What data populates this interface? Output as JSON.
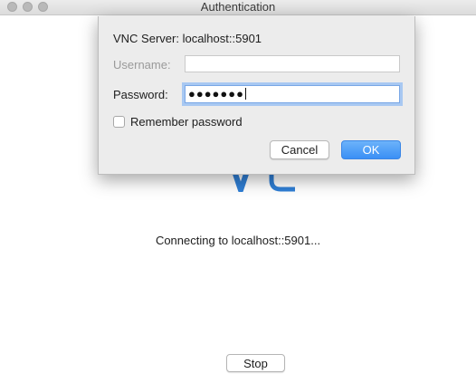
{
  "window": {
    "title": "Authentication"
  },
  "dialog": {
    "server_text": "VNC Server: localhost::5901",
    "username": {
      "label": "Username:",
      "value": ""
    },
    "password": {
      "label": "Password:",
      "masked_value": "●●●●●●●"
    },
    "remember": {
      "label": "Remember password",
      "checked": false
    },
    "buttons": {
      "cancel": "Cancel",
      "ok": "OK"
    }
  },
  "main": {
    "status_text": "Connecting to localhost::5901...",
    "stop_label": "Stop"
  },
  "colors": {
    "accent": "#3a8ff5",
    "focus_ring": "#a8c8f2",
    "logo_blue": "#2f7fd6"
  }
}
